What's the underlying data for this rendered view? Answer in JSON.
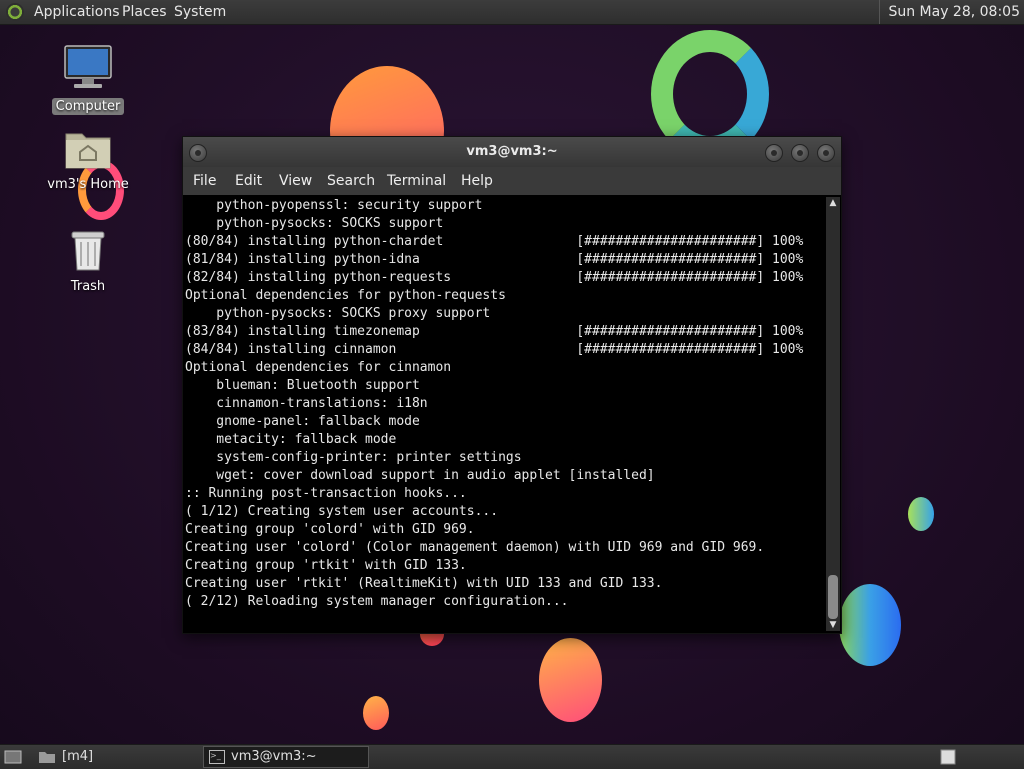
{
  "top_panel": {
    "menus": [
      "Applications",
      "Places",
      "System"
    ],
    "clock": "Sun May 28, 08:05"
  },
  "desktop": {
    "icons": [
      {
        "label": "Computer",
        "icon": "computer-icon"
      },
      {
        "label": "vm3's Home",
        "icon": "home-folder-icon"
      },
      {
        "label": "Trash",
        "icon": "trash-icon"
      }
    ]
  },
  "terminal": {
    "title": "vm3@vm3:~",
    "menu": [
      "File",
      "Edit",
      "View",
      "Search",
      "Terminal",
      "Help"
    ],
    "lines": [
      "    python-pyopenssl: security support",
      "    python-pysocks: SOCKS support",
      "(80/84) installing python-chardet                 [######################] 100%",
      "(81/84) installing python-idna                    [######################] 100%",
      "(82/84) installing python-requests                [######################] 100%",
      "Optional dependencies for python-requests",
      "    python-pysocks: SOCKS proxy support",
      "(83/84) installing timezonemap                    [######################] 100%",
      "(84/84) installing cinnamon                       [######################] 100%",
      "Optional dependencies for cinnamon",
      "    blueman: Bluetooth support",
      "    cinnamon-translations: i18n",
      "    gnome-panel: fallback mode",
      "    metacity: fallback mode",
      "    system-config-printer: printer settings",
      "    wget: cover download support in audio applet [installed]",
      ":: Running post-transaction hooks...",
      "( 1/12) Creating system user accounts...",
      "Creating group 'colord' with GID 969.",
      "Creating user 'colord' (Color management daemon) with UID 969 and GID 969.",
      "Creating group 'rtkit' with GID 133.",
      "Creating user 'rtkit' (RealtimeKit) with UID 133 and GID 133.",
      "( 2/12) Reloading system manager configuration..."
    ]
  },
  "bottom_panel": {
    "workspace_label": "[m4]",
    "task_label": "vm3@vm3:~"
  }
}
